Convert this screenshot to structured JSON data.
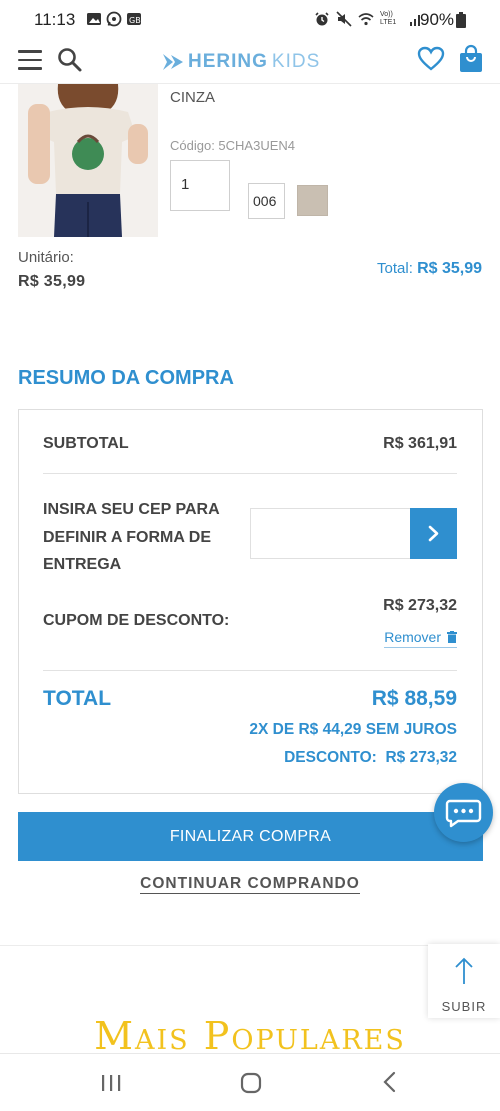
{
  "status_bar": {
    "time": "11:13",
    "battery": "90%",
    "network_label": "Vo)) LTE1"
  },
  "header": {
    "brand": "HERING",
    "brand_suffix": "KIDS"
  },
  "product": {
    "color_name": "CINZA",
    "code": "Código: 5CHA3UEN4",
    "quantity": "1",
    "size": "006",
    "swatch_color": "#c9bfb2",
    "unit_label": "Unitário:",
    "unit_price": "R$ 35,99",
    "total_label": "Total:",
    "total_value": "R$ 35,99"
  },
  "summary": {
    "title": "RESUMO DA COMPRA",
    "subtotal_label": "SUBTOTAL",
    "subtotal_value": "R$ 361,91",
    "cep_label_line1": "INSIRA SEU CEP PARA",
    "cep_label_line2": "DEFINIR A FORMA DE",
    "cep_label_line3": "ENTREGA",
    "cep_value": "",
    "coupon_label": "CUPOM DE DESCONTO:",
    "coupon_value": "R$ 273,32",
    "remove_label": "Remover",
    "total_label": "TOTAL",
    "total_value": "R$ 88,59",
    "installments": "2X DE R$ 44,29 SEM JUROS",
    "discount_label": "DESCONTO:",
    "discount_value": "R$ 273,32"
  },
  "actions": {
    "finalize_label": "FINALIZAR COMPRA",
    "continue_label": "CONTINUAR COMPRANDO",
    "scroll_top_label": "SUBIR"
  },
  "sections": {
    "popular_title": "Mais Populares"
  },
  "colors": {
    "accent": "#2f8fcf",
    "popular_title": "#f2c21e"
  },
  "icons": [
    "menu-icon",
    "search-icon",
    "logo-fish-icon",
    "heart-icon",
    "bag-icon",
    "chevron-right-icon",
    "trash-icon",
    "chat-icon",
    "arrow-up-icon",
    "nav-recents-icon",
    "nav-home-icon",
    "nav-back-icon"
  ]
}
